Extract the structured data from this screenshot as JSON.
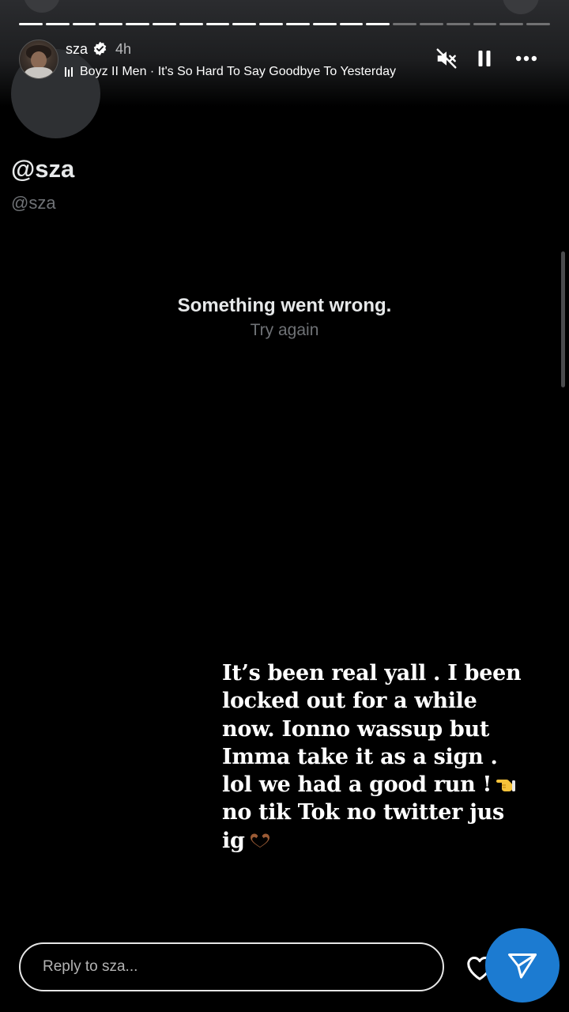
{
  "story": {
    "progress_segments_total": 20,
    "progress_segments_complete": 14,
    "current_segment_progress": 0.0
  },
  "header": {
    "username": "sza",
    "verified": true,
    "posted_ago": "4h",
    "music": "Boyz II Men · It's So Hard To Say Goodbye To Yesterday",
    "icons": {
      "mute": "speaker-muted-icon",
      "pause": "pause-icon",
      "more": "more-dots-icon"
    }
  },
  "embed": {
    "display_name": "@sza",
    "handle": "@sza",
    "error_title": "Something went wrong.",
    "error_action": "Try again"
  },
  "caption": {
    "lines": [
      "It’s been real yall . I been",
      "locked out for a while",
      "now. Ionno wassup but",
      "Imma take it as a sign .",
      "lol we had a good run !",
      "no tik Tok no twitter jus",
      "ig"
    ]
  },
  "reply": {
    "placeholder": "Reply to sza..."
  },
  "colors": {
    "accent": "#1c7bd1",
    "background": "#000000"
  }
}
